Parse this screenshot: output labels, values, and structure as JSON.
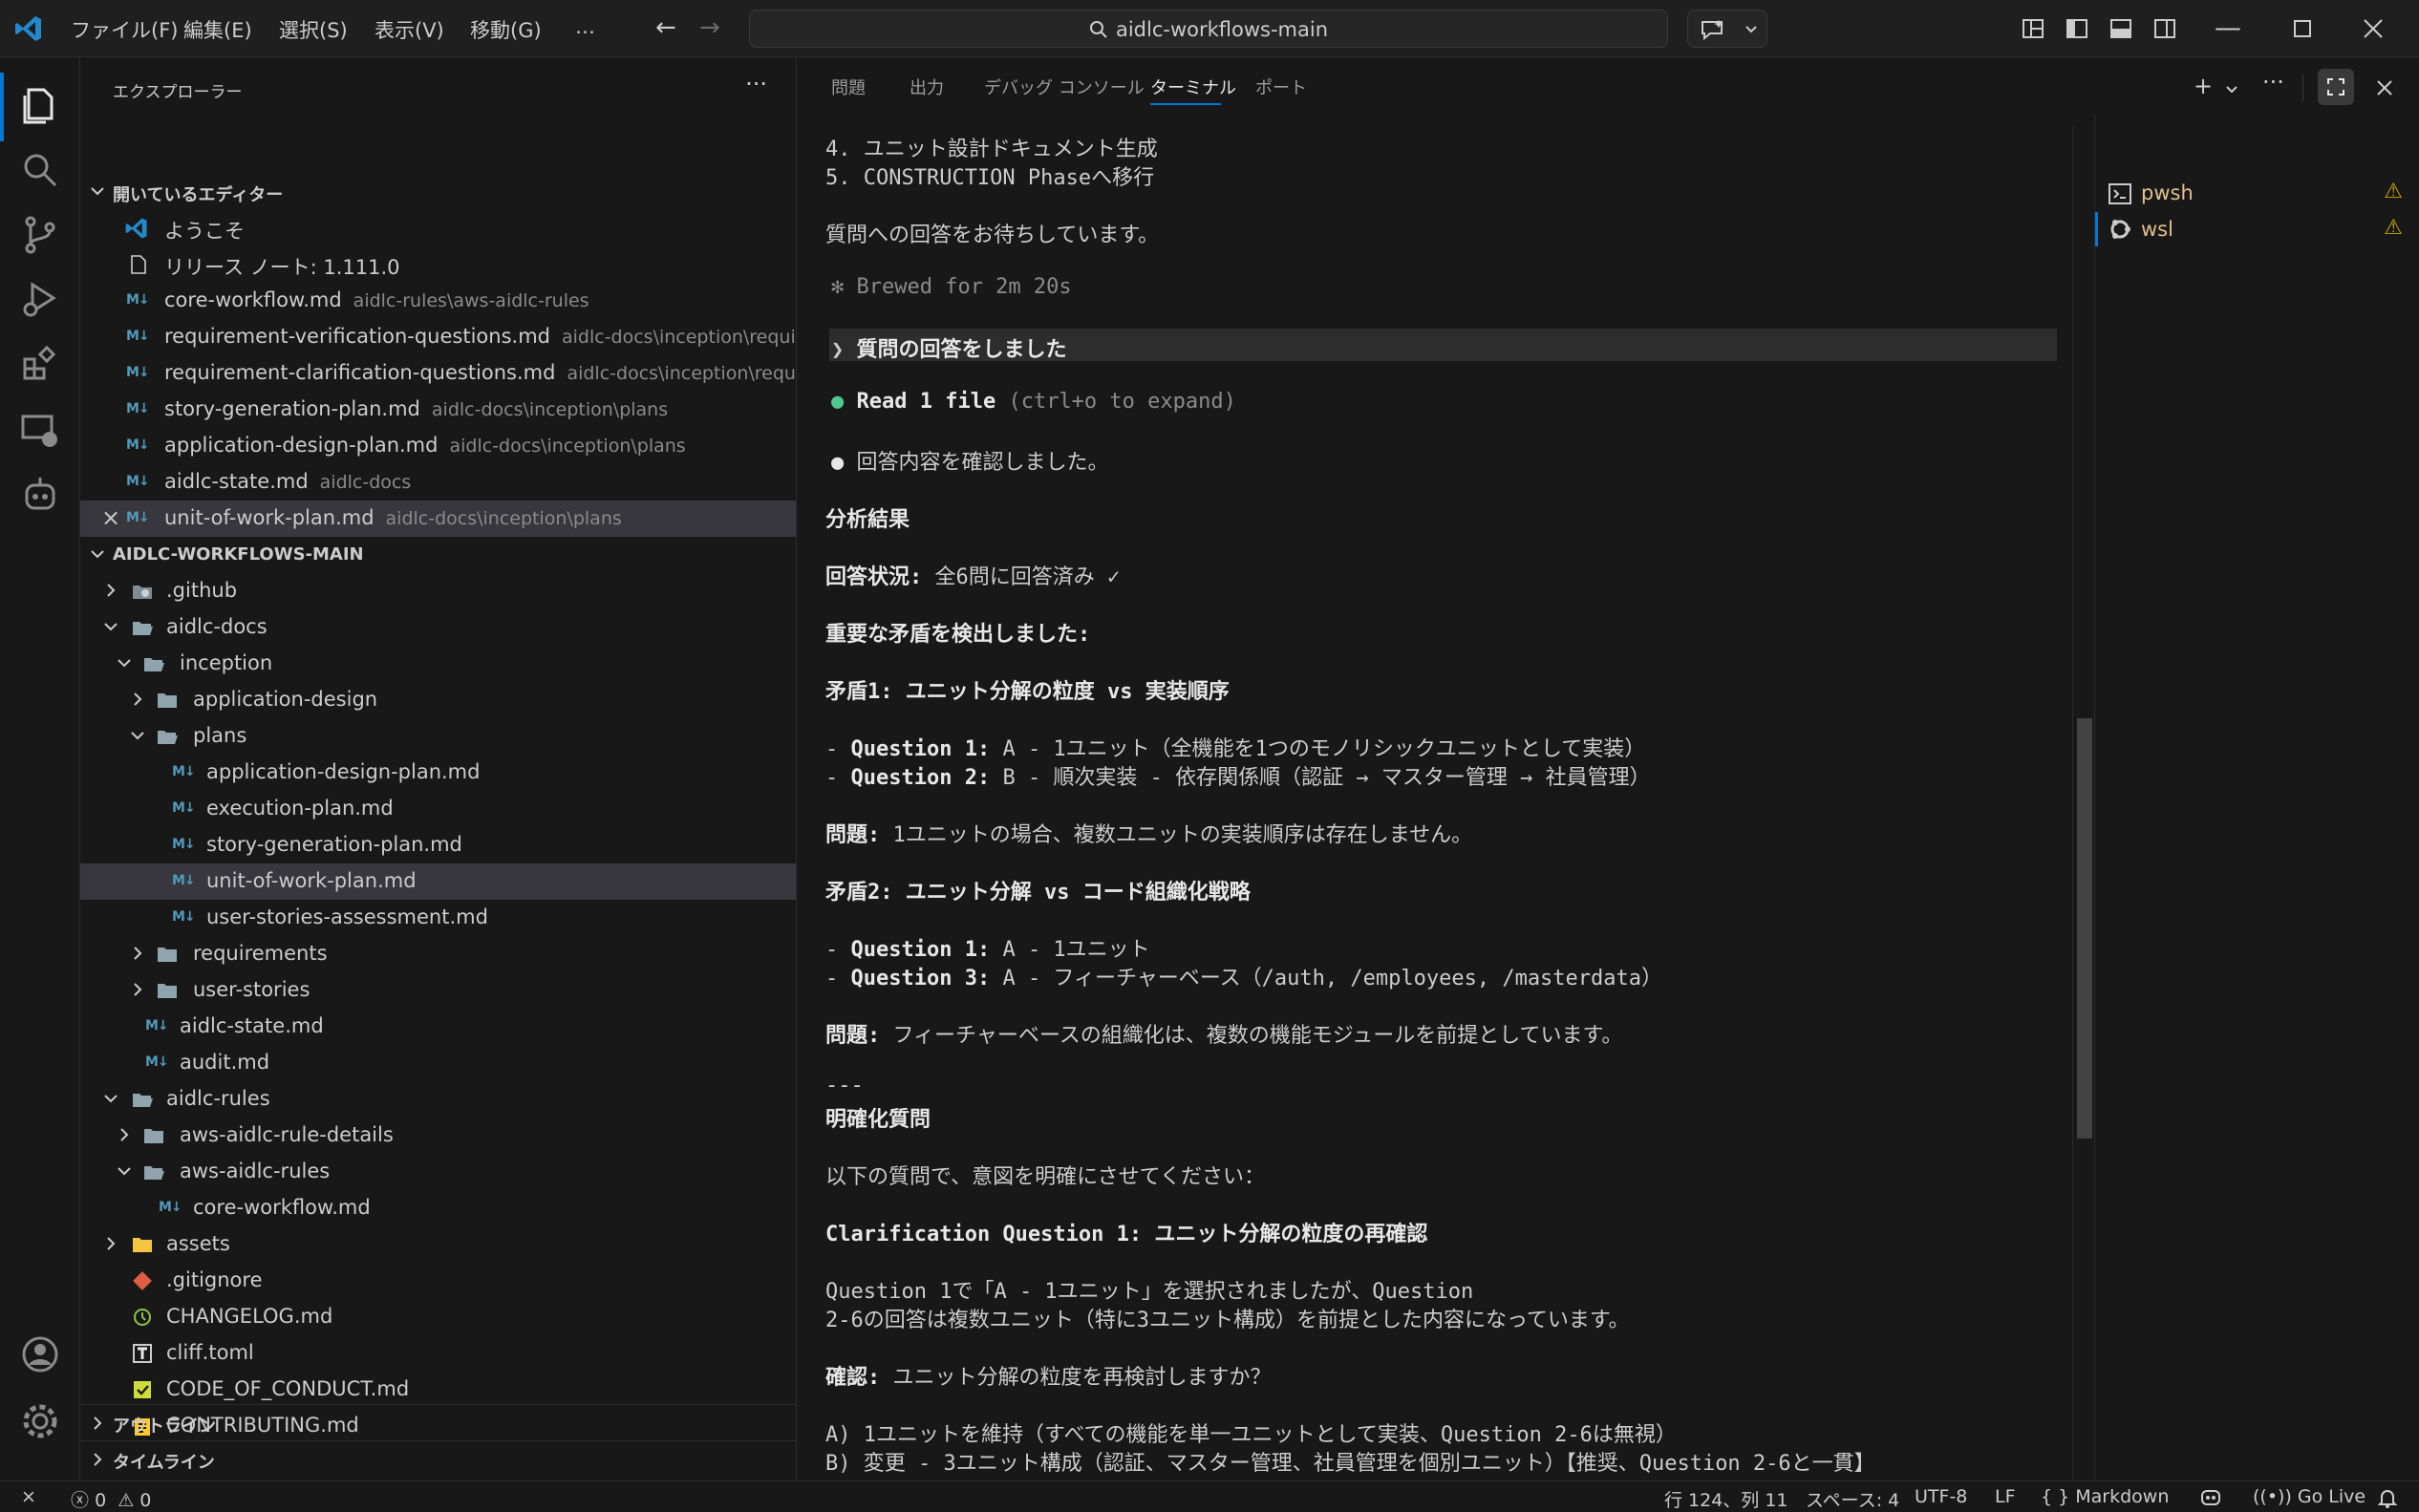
{
  "titlebar": {
    "menus": [
      "ファイル(F)",
      "編集(E)",
      "選択(S)",
      "表示(V)",
      "移動(G)",
      "…"
    ],
    "search_text": "aidlc-workflows-main"
  },
  "sidebar": {
    "title": "エクスプローラー",
    "open_editors_header": "開いているエディター",
    "open_editors": [
      {
        "name": "ようこそ",
        "desc": ""
      },
      {
        "name": "リリース ノート: 1.111.0",
        "desc": ""
      },
      {
        "name": "core-workflow.md",
        "desc": "aidlc-rules\\aws-aidlc-rules"
      },
      {
        "name": "requirement-verification-questions.md",
        "desc": "aidlc-docs\\inception\\requir..."
      },
      {
        "name": "requirement-clarification-questions.md",
        "desc": "aidlc-docs\\inception\\requi..."
      },
      {
        "name": "story-generation-plan.md",
        "desc": "aidlc-docs\\inception\\plans"
      },
      {
        "name": "application-design-plan.md",
        "desc": "aidlc-docs\\inception\\plans"
      },
      {
        "name": "aidlc-state.md",
        "desc": "aidlc-docs"
      },
      {
        "name": "unit-of-work-plan.md",
        "desc": "aidlc-docs\\inception\\plans"
      }
    ],
    "workspace_header": "AIDLC-WORKFLOWS-MAIN",
    "tree": [
      ".github",
      "aidlc-docs",
      "inception",
      "application-design",
      "plans",
      "application-design-plan.md",
      "execution-plan.md",
      "story-generation-plan.md",
      "unit-of-work-plan.md",
      "user-stories-assessment.md",
      "requirements",
      "user-stories",
      "aidlc-state.md",
      "audit.md",
      "aidlc-rules",
      "aws-aidlc-rule-details",
      "aws-aidlc-rules",
      "core-workflow.md",
      "assets",
      ".gitignore",
      "CHANGELOG.md",
      "cliff.toml",
      "CODE_OF_CONDUCT.md",
      "CONTRIBUTING.md"
    ],
    "outline": "アウトライン",
    "timeline": "タイムライン"
  },
  "panel": {
    "tabs": [
      "問題",
      "出力",
      "デバッグ コンソール",
      "ターミナル",
      "ポート"
    ],
    "terminals": [
      "pwsh",
      "wsl"
    ],
    "lines": {
      "l1": "4. ユニット設計ドキュメント生成",
      "l2": "5. CONSTRUCTION Phaseへ移行",
      "l3": "質問への回答をお待ちしています。",
      "brewed": "✻ Brewed for 2m 20s",
      "answered": "質問の回答をしました",
      "read_file": "Read 1 file",
      "read_hint": "(ctrl+o to expand)",
      "confirm": "回答内容を確認しました。",
      "analysis": "分析結果",
      "status_label": "回答状況:",
      "status_val": " 全6問に回答済み ✓",
      "conflict_found": "重要な矛盾を検出しました:",
      "c1_title": "矛盾1: ユニット分解の粒度 vs 実装順序",
      "c1_q1_label": "Question 1:",
      "c1_q1_val": " A - 1ユニット（全機能を1つのモノリシックユニットとして実装）",
      "c1_q2_label": "Question 2:",
      "c1_q2_val": " B - 順次実装 - 依存関係順（認証 → マスター管理 → 社員管理）",
      "p1_label": "問題:",
      "p1_val": " 1ユニットの場合、複数ユニットの実装順序は存在しません。",
      "c2_title": "矛盾2: ユニット分解 vs コード組織化戦略",
      "c2_q1_label": "Question 1:",
      "c2_q1_val": " A - 1ユニット",
      "c2_q3_label": "Question 3:",
      "c2_q3_val": " A - フィーチャーベース（/auth, /employees, /masterdata）",
      "p2_label": "問題:",
      "p2_val": " フィーチャーベースの組織化は、複数の機能モジュールを前提としています。",
      "sep": "---",
      "clarify": "明確化質問",
      "clarify_intro": "以下の質問で、意図を明確にさせてください：",
      "cq1": "Clarification Question 1: ユニット分解の粒度の再確認",
      "cq1_a": "Question 1で「A - 1ユニット」を選択されましたが、Question",
      "cq1_b": "2-6の回答は複数ユニット（特に3ユニット構成）を前提とした内容になっています。",
      "confirm_label": "確認:",
      "confirm_val": " ユニット分解の粒度を再検討しますか？",
      "opt_a": "A) 1ユニットを維持（すべての機能を単一ユニットとして実装、Question 2-6は無視）",
      "opt_b": "B) 変更 - 3ユニット構成（認証、マスター管理、社員管理を個別ユニット）【推奨、Question 2-6と一貫】"
    }
  },
  "statusbar": {
    "errors": "0",
    "warnings": "0",
    "position": "行 124、列 11",
    "spaces": "スペース: 4",
    "encoding": "UTF-8",
    "eol": "LF",
    "language": "Markdown",
    "golive": "Go Live"
  },
  "colors": {
    "accent": "#0078d4",
    "markdown_icon": "#519aba",
    "terminal_name": "#e2c08d",
    "warning": "#cca700"
  }
}
